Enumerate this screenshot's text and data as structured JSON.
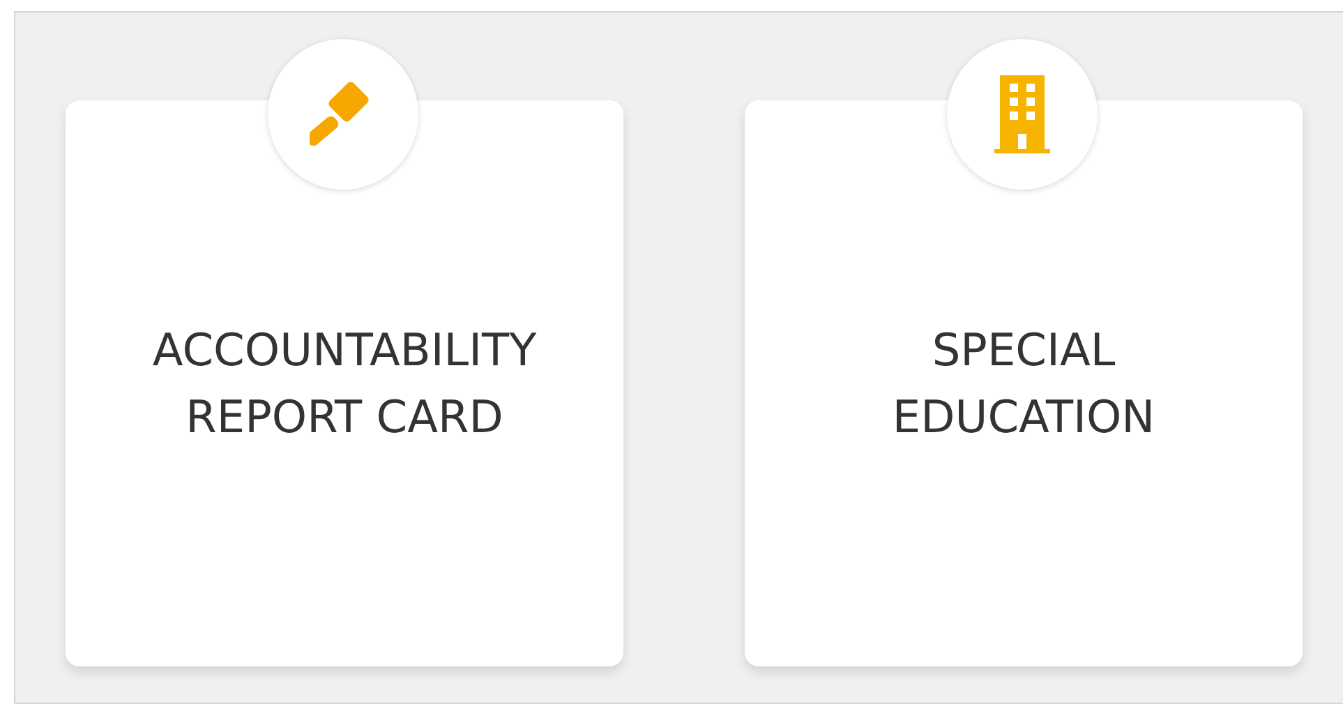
{
  "cards": [
    {
      "kind": "gavel",
      "title": "ACCOUNTABILITY REPORT CARD"
    },
    {
      "kind": "building",
      "title": "SPECIAL EDUCATION"
    }
  ]
}
